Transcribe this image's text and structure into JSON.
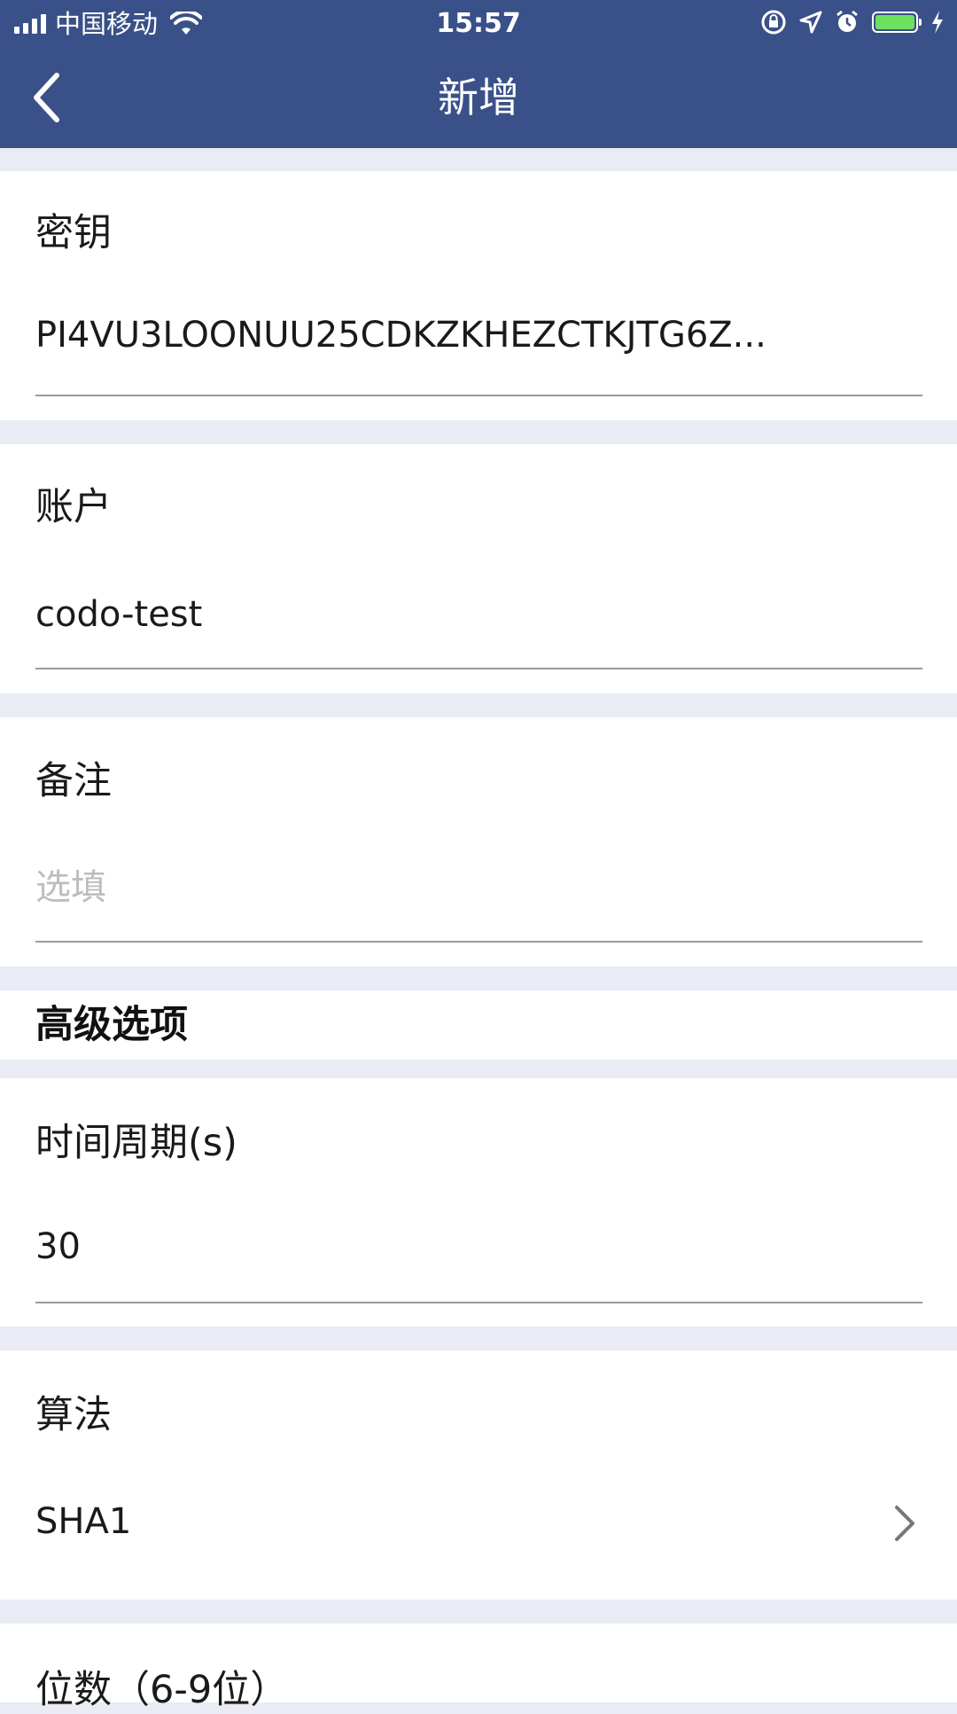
{
  "status_bar": {
    "carrier": "中国移动",
    "time": "15:57"
  },
  "nav": {
    "title": "新增"
  },
  "fields": {
    "secret": {
      "label": "密钥",
      "value": "PI4VU3LOONUU25CDKZKHEZCTKJTG6Z..."
    },
    "account": {
      "label": "账户",
      "value": "codo-test"
    },
    "note": {
      "label": "备注",
      "placeholder": "选填"
    }
  },
  "advanced": {
    "title": "高级选项",
    "period": {
      "label": "时间周期(s)",
      "value": "30"
    },
    "algorithm": {
      "label": "算法",
      "value": "SHA1"
    },
    "digits": {
      "label": "位数（6-9位）"
    }
  },
  "colors": {
    "header": "#3a5088",
    "page_bg": "#e9ebf5",
    "battery": "#6fe05f"
  }
}
